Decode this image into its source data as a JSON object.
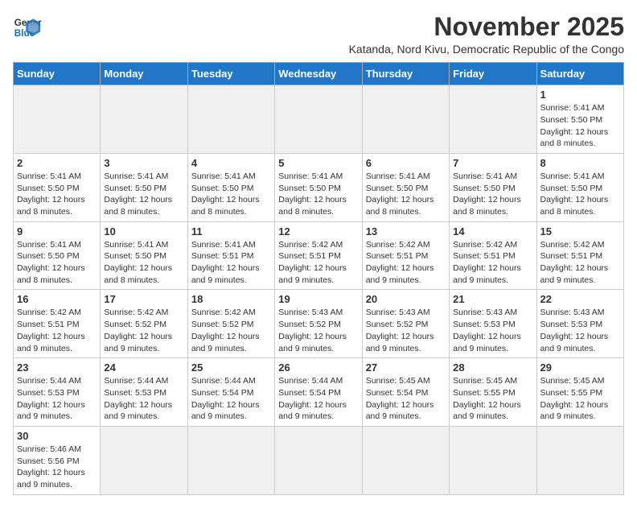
{
  "header": {
    "logo_line1": "General",
    "logo_line2": "Blue",
    "title": "November 2025",
    "subtitle": "Katanda, Nord Kivu, Democratic Republic of the Congo"
  },
  "weekdays": [
    "Sunday",
    "Monday",
    "Tuesday",
    "Wednesday",
    "Thursday",
    "Friday",
    "Saturday"
  ],
  "days": [
    {
      "date": null
    },
    {
      "date": null
    },
    {
      "date": null
    },
    {
      "date": null
    },
    {
      "date": null
    },
    {
      "date": null
    },
    {
      "date": 1,
      "sunrise": "5:41 AM",
      "sunset": "5:50 PM",
      "daylight": "12 hours and 8 minutes."
    },
    {
      "date": 2,
      "sunrise": "5:41 AM",
      "sunset": "5:50 PM",
      "daylight": "12 hours and 8 minutes."
    },
    {
      "date": 3,
      "sunrise": "5:41 AM",
      "sunset": "5:50 PM",
      "daylight": "12 hours and 8 minutes."
    },
    {
      "date": 4,
      "sunrise": "5:41 AM",
      "sunset": "5:50 PM",
      "daylight": "12 hours and 8 minutes."
    },
    {
      "date": 5,
      "sunrise": "5:41 AM",
      "sunset": "5:50 PM",
      "daylight": "12 hours and 8 minutes."
    },
    {
      "date": 6,
      "sunrise": "5:41 AM",
      "sunset": "5:50 PM",
      "daylight": "12 hours and 8 minutes."
    },
    {
      "date": 7,
      "sunrise": "5:41 AM",
      "sunset": "5:50 PM",
      "daylight": "12 hours and 8 minutes."
    },
    {
      "date": 8,
      "sunrise": "5:41 AM",
      "sunset": "5:50 PM",
      "daylight": "12 hours and 8 minutes."
    },
    {
      "date": 9,
      "sunrise": "5:41 AM",
      "sunset": "5:50 PM",
      "daylight": "12 hours and 8 minutes."
    },
    {
      "date": 10,
      "sunrise": "5:41 AM",
      "sunset": "5:50 PM",
      "daylight": "12 hours and 8 minutes."
    },
    {
      "date": 11,
      "sunrise": "5:41 AM",
      "sunset": "5:51 PM",
      "daylight": "12 hours and 9 minutes."
    },
    {
      "date": 12,
      "sunrise": "5:42 AM",
      "sunset": "5:51 PM",
      "daylight": "12 hours and 9 minutes."
    },
    {
      "date": 13,
      "sunrise": "5:42 AM",
      "sunset": "5:51 PM",
      "daylight": "12 hours and 9 minutes."
    },
    {
      "date": 14,
      "sunrise": "5:42 AM",
      "sunset": "5:51 PM",
      "daylight": "12 hours and 9 minutes."
    },
    {
      "date": 15,
      "sunrise": "5:42 AM",
      "sunset": "5:51 PM",
      "daylight": "12 hours and 9 minutes."
    },
    {
      "date": 16,
      "sunrise": "5:42 AM",
      "sunset": "5:51 PM",
      "daylight": "12 hours and 9 minutes."
    },
    {
      "date": 17,
      "sunrise": "5:42 AM",
      "sunset": "5:52 PM",
      "daylight": "12 hours and 9 minutes."
    },
    {
      "date": 18,
      "sunrise": "5:42 AM",
      "sunset": "5:52 PM",
      "daylight": "12 hours and 9 minutes."
    },
    {
      "date": 19,
      "sunrise": "5:43 AM",
      "sunset": "5:52 PM",
      "daylight": "12 hours and 9 minutes."
    },
    {
      "date": 20,
      "sunrise": "5:43 AM",
      "sunset": "5:52 PM",
      "daylight": "12 hours and 9 minutes."
    },
    {
      "date": 21,
      "sunrise": "5:43 AM",
      "sunset": "5:53 PM",
      "daylight": "12 hours and 9 minutes."
    },
    {
      "date": 22,
      "sunrise": "5:43 AM",
      "sunset": "5:53 PM",
      "daylight": "12 hours and 9 minutes."
    },
    {
      "date": 23,
      "sunrise": "5:44 AM",
      "sunset": "5:53 PM",
      "daylight": "12 hours and 9 minutes."
    },
    {
      "date": 24,
      "sunrise": "5:44 AM",
      "sunset": "5:53 PM",
      "daylight": "12 hours and 9 minutes."
    },
    {
      "date": 25,
      "sunrise": "5:44 AM",
      "sunset": "5:54 PM",
      "daylight": "12 hours and 9 minutes."
    },
    {
      "date": 26,
      "sunrise": "5:44 AM",
      "sunset": "5:54 PM",
      "daylight": "12 hours and 9 minutes."
    },
    {
      "date": 27,
      "sunrise": "5:45 AM",
      "sunset": "5:54 PM",
      "daylight": "12 hours and 9 minutes."
    },
    {
      "date": 28,
      "sunrise": "5:45 AM",
      "sunset": "5:55 PM",
      "daylight": "12 hours and 9 minutes."
    },
    {
      "date": 29,
      "sunrise": "5:45 AM",
      "sunset": "5:55 PM",
      "daylight": "12 hours and 9 minutes."
    },
    {
      "date": 30,
      "sunrise": "5:46 AM",
      "sunset": "5:56 PM",
      "daylight": "12 hours and 9 minutes."
    },
    {
      "date": null
    },
    {
      "date": null
    },
    {
      "date": null
    },
    {
      "date": null
    },
    {
      "date": null
    },
    {
      "date": null
    }
  ]
}
